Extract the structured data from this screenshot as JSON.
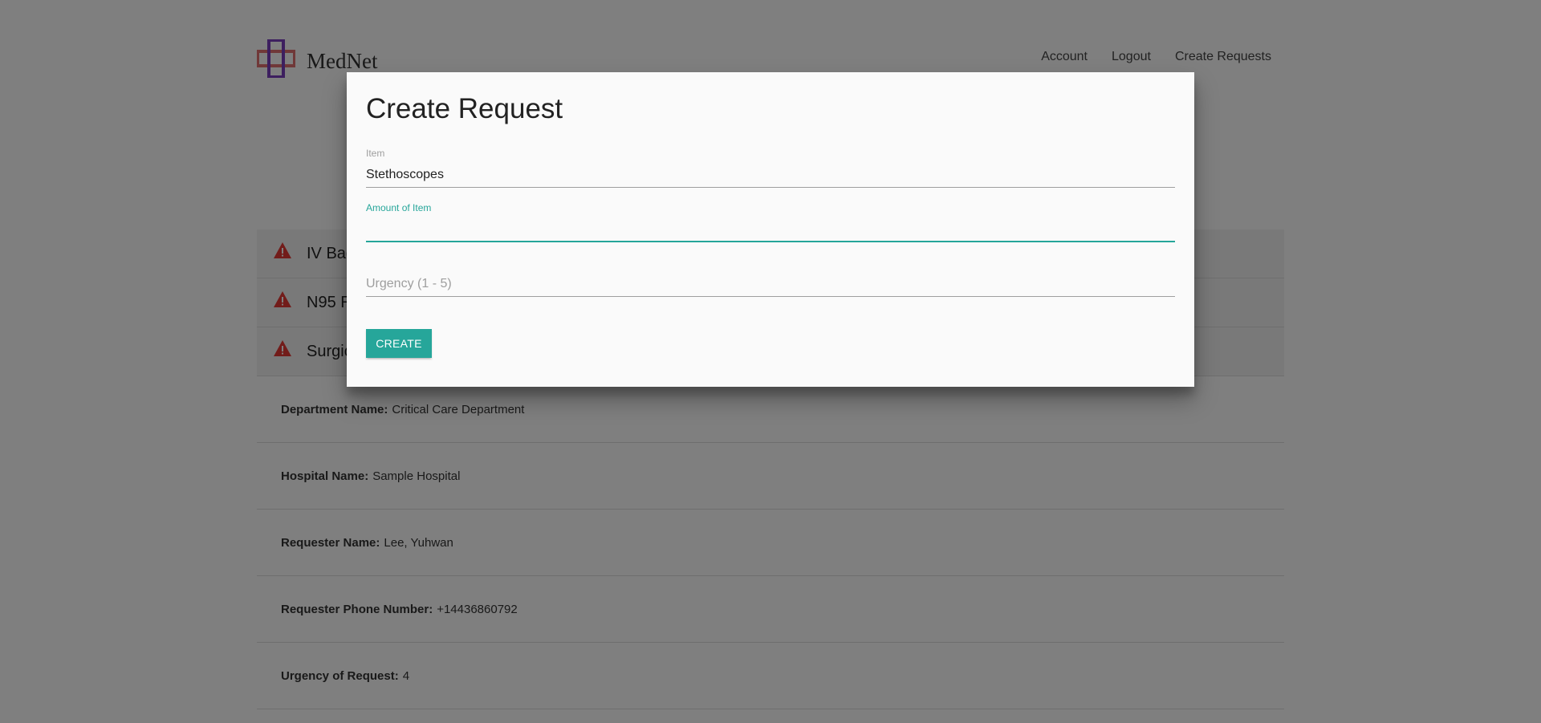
{
  "header": {
    "brand_name": "MedNet",
    "nav": [
      {
        "label": "Account"
      },
      {
        "label": "Logout"
      },
      {
        "label": "Create Requests"
      }
    ]
  },
  "requests": [
    {
      "title": "IV Bag"
    },
    {
      "title": "N95 R"
    },
    {
      "title": "Surgic"
    }
  ],
  "details": [
    {
      "label": "Department Name:",
      "value": "Critical Care Department"
    },
    {
      "label": "Hospital Name:",
      "value": "Sample Hospital"
    },
    {
      "label": "Requester Name:",
      "value": "Lee, Yuhwan"
    },
    {
      "label": "Requester Phone Number:",
      "value": "+14436860792"
    },
    {
      "label": "Urgency of Request:",
      "value": "4"
    }
  ],
  "modal": {
    "title": "Create Request",
    "item_label": "Item",
    "item_value": "Stethoscopes",
    "amount_label": "Amount of Item",
    "amount_value": "",
    "urgency_placeholder": "Urgency (1 - 5)",
    "create_label": "CREATE"
  },
  "colors": {
    "accent": "#26a69a",
    "warning": "#e53935",
    "logo_red": "#e57373",
    "logo_purple": "#7b3fbf"
  }
}
